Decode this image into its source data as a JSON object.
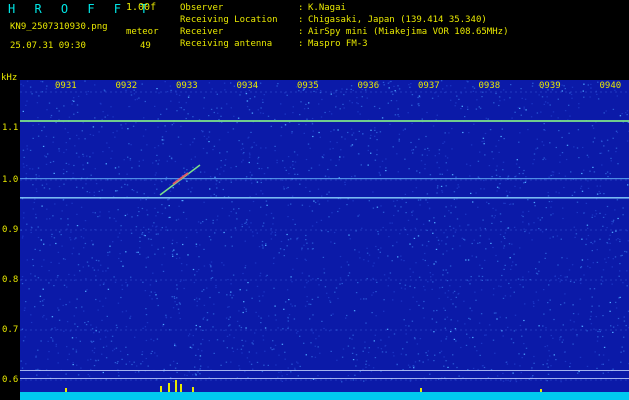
{
  "header": {
    "app_title": "H R O F F T",
    "version": "1.00f",
    "filename": "KN9_2507310930.png",
    "datetime": "25.07.31 09:30",
    "meteor_label": "meteor",
    "meteor_count": "49"
  },
  "info": {
    "observer_label": "Observer",
    "observer_value": "K.Nagai",
    "location_label": "Receiving Location",
    "location_value": "Chigasaki, Japan (139.414 35.340)",
    "receiver_label": "Receiver",
    "receiver_value": "AirSpy mini (Miakejima VOR 108.65MHz)",
    "antenna_label": "Receiving antenna",
    "antenna_value": "Maspro FM-3",
    "colon": ":"
  },
  "axis": {
    "unit": "kHz",
    "freq_labels": [
      "1.1",
      "1.0",
      "0.9",
      "0.8",
      "0.7",
      "0.6"
    ],
    "time_labels": [
      "0931",
      "0932",
      "0933",
      "0934",
      "0935",
      "0936",
      "0937",
      "0938",
      "0939",
      "0940"
    ]
  },
  "colors": {
    "background": "#0b1aa8",
    "noise_light": "#2a5bd6",
    "signal_line": "#7be08a",
    "meteor": "#e05a6a",
    "label_yellow": "#e8e800",
    "title_cyan": "#00e5e5",
    "bottom_bar": "#00c8f0"
  }
}
